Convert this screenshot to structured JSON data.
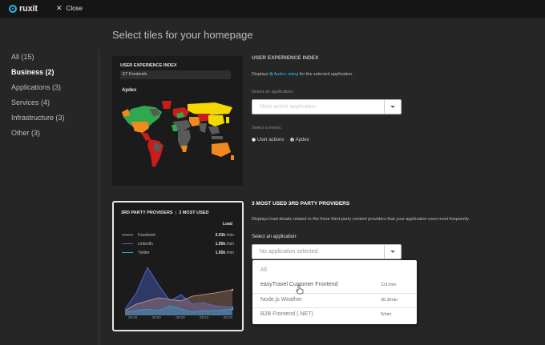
{
  "topbar": {
    "logo_text": "ruxit",
    "close_label": "Close",
    "close_icon": "x-icon"
  },
  "page": {
    "title": "Select tiles for your homepage"
  },
  "sidebar": {
    "items": [
      {
        "label": "All (15)",
        "active": false
      },
      {
        "label": "Business (2)",
        "active": true
      },
      {
        "label": "Applications (3)",
        "active": false
      },
      {
        "label": "Services (4)",
        "active": false
      },
      {
        "label": "Infrastructure (3)",
        "active": false
      },
      {
        "label": "Other (3)",
        "active": false
      }
    ]
  },
  "tile1": {
    "header": "USER EXPERIENCE INDEX",
    "app_name": "ET Frontends",
    "metric_label": "Apdex",
    "map_colors": {
      "excellent": "#f5d800",
      "good": "#2fa84f",
      "fair": "#f08a1c",
      "poor": "#c91c1c",
      "no_data": "#5a5a5a"
    }
  },
  "section1": {
    "title": "USER EXPERIENCE INDEX",
    "desc_prefix": "Displays",
    "desc_link": "Apdex rating",
    "desc_suffix": "for the selected application.",
    "app_label": "Select an application:",
    "app_value": "Most active application",
    "metric_label": "Select a metric:",
    "radios": [
      {
        "label": "User actions",
        "checked": false
      },
      {
        "label": "Apdex",
        "checked": true
      }
    ]
  },
  "tile2": {
    "header_left": "3RD PARTY PROVIDERS",
    "header_right": "3 MOST USED",
    "load_label": "Load",
    "rows": [
      {
        "name": "Facebook",
        "value": "2.03k",
        "unit": "/min",
        "color": "#d99a86"
      },
      {
        "name": "LinkedIn",
        "value": "1.95k",
        "unit": "/min",
        "color": "#4a5fc8"
      },
      {
        "name": "Twitter",
        "value": "1.95k",
        "unit": "/min",
        "color": "#2aa7d6"
      }
    ],
    "x_labels": [
      "08:40",
      "08:50",
      "09:00",
      "09:10",
      "09:20"
    ]
  },
  "section2": {
    "title": "3 MOST USED 3RD PARTY PROVIDERS",
    "desc": "Displays load details related to the three third-party content providers that your application uses most frequently.",
    "app_label": "Select an application:",
    "app_placeholder": "No application selected"
  },
  "dropdown": {
    "items": [
      {
        "name": "All",
        "rate": ""
      },
      {
        "name": "easyTravel Customer Frontend",
        "rate": "121/min"
      },
      {
        "name": "Node.js Weather",
        "rate": "36.3/min"
      },
      {
        "name": "B2B Frontend (.NET)",
        "rate": "5/min"
      }
    ]
  }
}
